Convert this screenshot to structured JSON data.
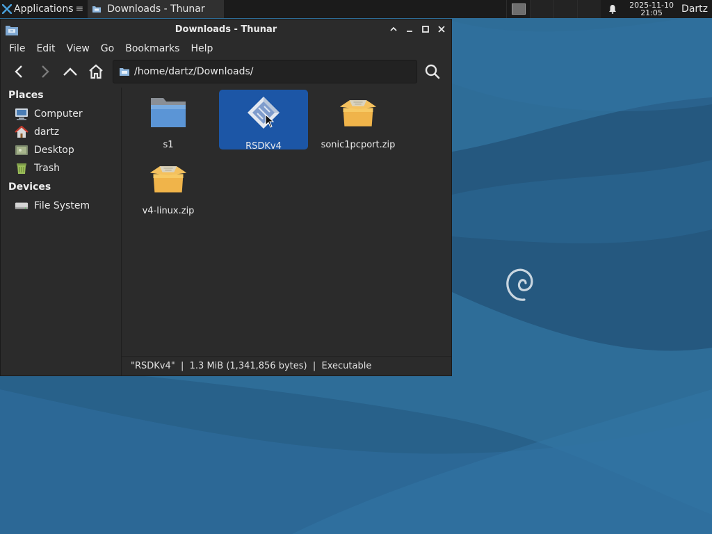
{
  "panel": {
    "applications_label": "Applications",
    "task_title": "Downloads - Thunar",
    "clock_date": "2025-11-10",
    "clock_time": "21:05",
    "user": "Dartz"
  },
  "window": {
    "title": "Downloads - Thunar",
    "menu": [
      "File",
      "Edit",
      "View",
      "Go",
      "Bookmarks",
      "Help"
    ],
    "location_value": "/home/dartz/Downloads/"
  },
  "sidebar": {
    "places_heading": "Places",
    "places": [
      {
        "label": "Computer",
        "icon": "computer-icon"
      },
      {
        "label": "dartz",
        "icon": "home-folder-icon"
      },
      {
        "label": "Desktop",
        "icon": "desktop-icon"
      },
      {
        "label": "Trash",
        "icon": "trash-icon"
      }
    ],
    "devices_heading": "Devices",
    "devices": [
      {
        "label": "File System",
        "icon": "drive-icon"
      }
    ]
  },
  "files": [
    {
      "name": "s1",
      "icon": "folder-icon",
      "selected": false
    },
    {
      "name": "RSDKv4",
      "icon": "executable-icon",
      "selected": true
    },
    {
      "name": "sonic1pcport.zip",
      "icon": "archive-icon",
      "selected": false
    },
    {
      "name": "v4-linux.zip",
      "icon": "archive-icon",
      "selected": false
    }
  ],
  "status": "\"RSDKv4\"  |  1.3 MiB (1,341,856 bytes)  |  Executable",
  "colors": {
    "desktop_bg": "#2d6a95",
    "selection": "#1c56a6",
    "window_bg": "#2b2b2b",
    "panel_bg": "#1b1b1b"
  }
}
